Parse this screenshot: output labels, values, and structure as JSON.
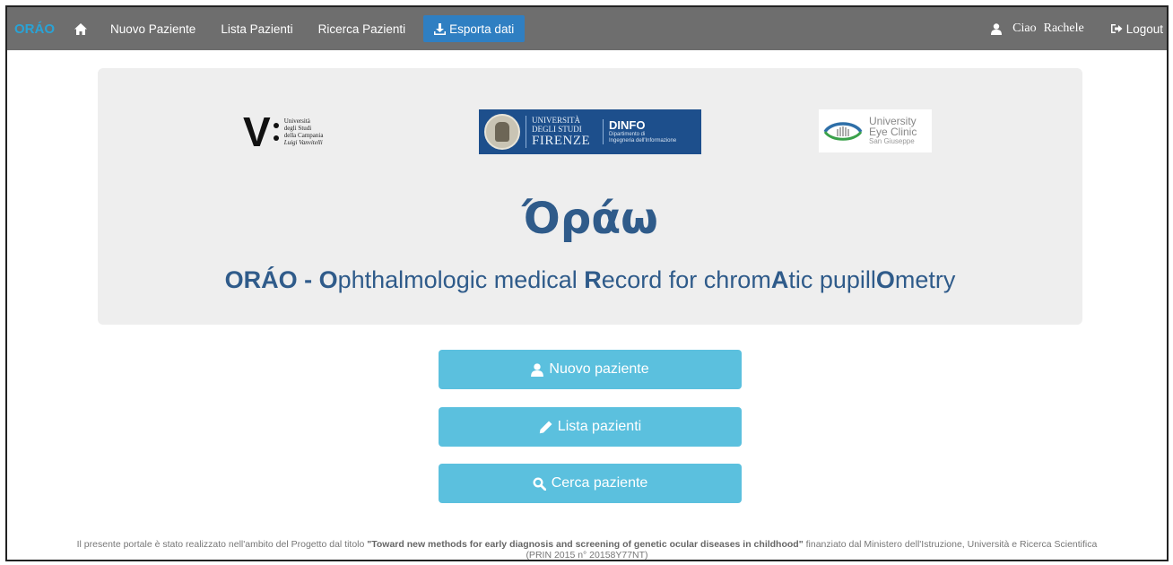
{
  "navbar": {
    "brand": "ORÁO",
    "items": [
      {
        "label": "Nuovo Paziente"
      },
      {
        "label": "Lista Pazienti"
      },
      {
        "label": "Ricerca Pazienti"
      },
      {
        "label": "Esporta dati"
      }
    ],
    "greeting": "Ciao",
    "user_name": "Rachele",
    "logout": "Logout"
  },
  "logos": {
    "vanvitelli": {
      "letter": "V",
      "lines": [
        "Università",
        "degli Studi",
        "della Campania",
        "Luigi Vanvitelli"
      ]
    },
    "firenze": {
      "line1": "UNIVERSITÀ",
      "line2": "DEGLI STUDI",
      "line3": "FIRENZE",
      "dept": "DINFO",
      "dept_sub1": "Dipartimento di",
      "dept_sub2": "Ingegneria dell'Informazione"
    },
    "eye_clinic": {
      "line1": "University",
      "line2": "Eye Clinic",
      "line3": "San Giuseppe"
    }
  },
  "hero": {
    "greek_title": "Όράω",
    "subtitle_parts": [
      "ORÁO - ",
      "O",
      "phthalmologic medical ",
      "R",
      "ecord for chrom",
      "A",
      "tic pupill",
      "O",
      "metry"
    ]
  },
  "buttons": {
    "new_patient": "Nuovo paziente",
    "patient_list": "Lista pazienti",
    "search_patient": "Cerca paziente"
  },
  "footer": {
    "text_before": "Il presente portale è stato realizzato nell'ambito del Progetto dal titolo ",
    "project_title": "\"Toward new methods for early diagnosis and screening of genetic ocular diseases in childhood\"",
    "text_after": " finanziato dal Ministero dell'Istruzione, Università e Ricerca Scientifica",
    "grant": "(PRIN 2015 n° 20158Y77NT)"
  },
  "colors": {
    "navbar_bg": "#6e6e6e",
    "brand": "#29a3d6",
    "active_tab": "#2f7fc2",
    "title": "#2f5b8a",
    "button": "#5bc0de"
  },
  "icons": {
    "home": "home-icon",
    "download": "download-icon",
    "user": "user-icon",
    "logout": "logout-icon",
    "pencil": "pencil-icon",
    "search": "search-icon"
  }
}
